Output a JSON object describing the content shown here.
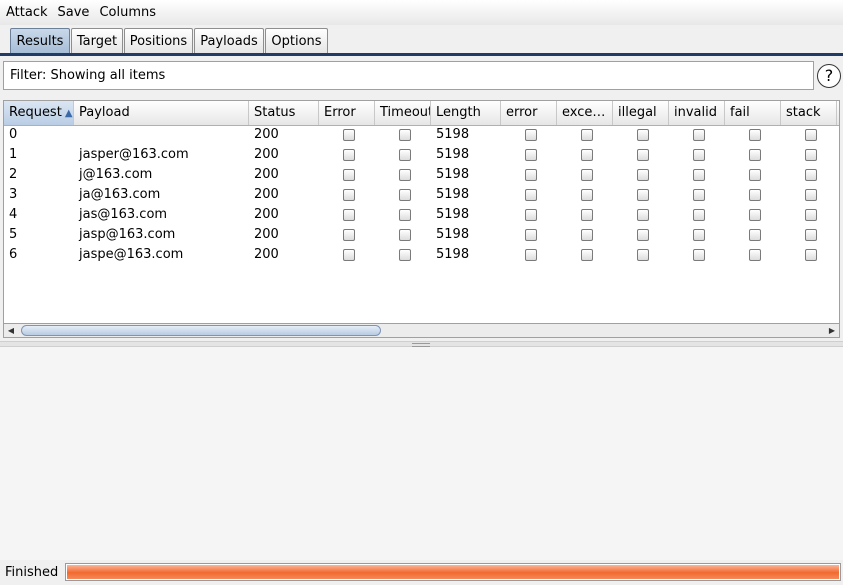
{
  "menu": [
    "Attack",
    "Save",
    "Columns"
  ],
  "tabs": [
    {
      "label": "Results",
      "active": true
    },
    {
      "label": "Target",
      "active": false
    },
    {
      "label": "Positions",
      "active": false
    },
    {
      "label": "Payloads",
      "active": false
    },
    {
      "label": "Options",
      "active": false
    }
  ],
  "filter": {
    "text": "Filter: Showing all items"
  },
  "help_icon": "?",
  "table": {
    "columns": [
      {
        "label": "Request",
        "sorted": "ascending"
      },
      {
        "label": "Payload"
      },
      {
        "label": "Status"
      },
      {
        "label": "Error"
      },
      {
        "label": "Timeout"
      },
      {
        "label": "Length"
      },
      {
        "label": "error"
      },
      {
        "label": "exce…"
      },
      {
        "label": "illegal"
      },
      {
        "label": "invalid"
      },
      {
        "label": "fail"
      },
      {
        "label": "stack"
      }
    ],
    "rows": [
      {
        "request": "0",
        "payload": "",
        "status": "200",
        "length": "5198"
      },
      {
        "request": "1",
        "payload": "jasper@163.com",
        "status": "200",
        "length": "5198"
      },
      {
        "request": "2",
        "payload": "j@163.com",
        "status": "200",
        "length": "5198"
      },
      {
        "request": "3",
        "payload": "ja@163.com",
        "status": "200",
        "length": "5198"
      },
      {
        "request": "4",
        "payload": "jas@163.com",
        "status": "200",
        "length": "5198"
      },
      {
        "request": "5",
        "payload": "jasp@163.com",
        "status": "200",
        "length": "5198"
      },
      {
        "request": "6",
        "payload": "jaspe@163.com",
        "status": "200",
        "length": "5198"
      }
    ]
  },
  "status": {
    "text": "Finished",
    "progress": 1.0,
    "progress_color": "#f26a2f"
  }
}
